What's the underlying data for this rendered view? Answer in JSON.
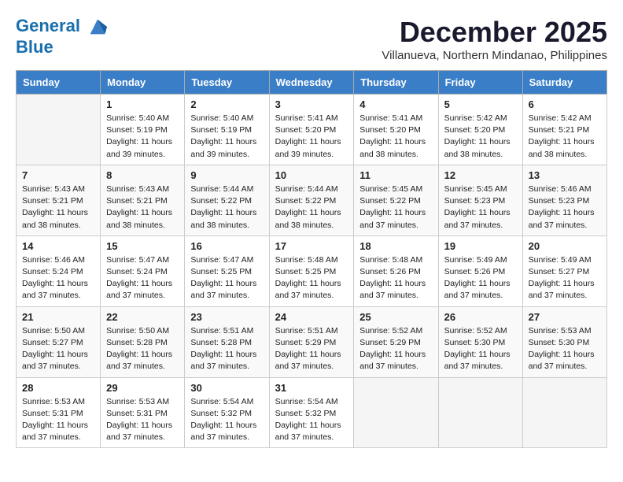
{
  "header": {
    "logo_line1": "General",
    "logo_line2": "Blue",
    "month_title": "December 2025",
    "subtitle": "Villanueva, Northern Mindanao, Philippines"
  },
  "days_of_week": [
    "Sunday",
    "Monday",
    "Tuesday",
    "Wednesday",
    "Thursday",
    "Friday",
    "Saturday"
  ],
  "weeks": [
    [
      {
        "day": "",
        "empty": true
      },
      {
        "day": "1",
        "sunrise": "5:40 AM",
        "sunset": "5:19 PM",
        "daylight": "11 hours and 39 minutes."
      },
      {
        "day": "2",
        "sunrise": "5:40 AM",
        "sunset": "5:19 PM",
        "daylight": "11 hours and 39 minutes."
      },
      {
        "day": "3",
        "sunrise": "5:41 AM",
        "sunset": "5:20 PM",
        "daylight": "11 hours and 39 minutes."
      },
      {
        "day": "4",
        "sunrise": "5:41 AM",
        "sunset": "5:20 PM",
        "daylight": "11 hours and 38 minutes."
      },
      {
        "day": "5",
        "sunrise": "5:42 AM",
        "sunset": "5:20 PM",
        "daylight": "11 hours and 38 minutes."
      },
      {
        "day": "6",
        "sunrise": "5:42 AM",
        "sunset": "5:21 PM",
        "daylight": "11 hours and 38 minutes."
      }
    ],
    [
      {
        "day": "7",
        "sunrise": "5:43 AM",
        "sunset": "5:21 PM",
        "daylight": "11 hours and 38 minutes."
      },
      {
        "day": "8",
        "sunrise": "5:43 AM",
        "sunset": "5:21 PM",
        "daylight": "11 hours and 38 minutes."
      },
      {
        "day": "9",
        "sunrise": "5:44 AM",
        "sunset": "5:22 PM",
        "daylight": "11 hours and 38 minutes."
      },
      {
        "day": "10",
        "sunrise": "5:44 AM",
        "sunset": "5:22 PM",
        "daylight": "11 hours and 38 minutes."
      },
      {
        "day": "11",
        "sunrise": "5:45 AM",
        "sunset": "5:22 PM",
        "daylight": "11 hours and 37 minutes."
      },
      {
        "day": "12",
        "sunrise": "5:45 AM",
        "sunset": "5:23 PM",
        "daylight": "11 hours and 37 minutes."
      },
      {
        "day": "13",
        "sunrise": "5:46 AM",
        "sunset": "5:23 PM",
        "daylight": "11 hours and 37 minutes."
      }
    ],
    [
      {
        "day": "14",
        "sunrise": "5:46 AM",
        "sunset": "5:24 PM",
        "daylight": "11 hours and 37 minutes."
      },
      {
        "day": "15",
        "sunrise": "5:47 AM",
        "sunset": "5:24 PM",
        "daylight": "11 hours and 37 minutes."
      },
      {
        "day": "16",
        "sunrise": "5:47 AM",
        "sunset": "5:25 PM",
        "daylight": "11 hours and 37 minutes."
      },
      {
        "day": "17",
        "sunrise": "5:48 AM",
        "sunset": "5:25 PM",
        "daylight": "11 hours and 37 minutes."
      },
      {
        "day": "18",
        "sunrise": "5:48 AM",
        "sunset": "5:26 PM",
        "daylight": "11 hours and 37 minutes."
      },
      {
        "day": "19",
        "sunrise": "5:49 AM",
        "sunset": "5:26 PM",
        "daylight": "11 hours and 37 minutes."
      },
      {
        "day": "20",
        "sunrise": "5:49 AM",
        "sunset": "5:27 PM",
        "daylight": "11 hours and 37 minutes."
      }
    ],
    [
      {
        "day": "21",
        "sunrise": "5:50 AM",
        "sunset": "5:27 PM",
        "daylight": "11 hours and 37 minutes."
      },
      {
        "day": "22",
        "sunrise": "5:50 AM",
        "sunset": "5:28 PM",
        "daylight": "11 hours and 37 minutes."
      },
      {
        "day": "23",
        "sunrise": "5:51 AM",
        "sunset": "5:28 PM",
        "daylight": "11 hours and 37 minutes."
      },
      {
        "day": "24",
        "sunrise": "5:51 AM",
        "sunset": "5:29 PM",
        "daylight": "11 hours and 37 minutes."
      },
      {
        "day": "25",
        "sunrise": "5:52 AM",
        "sunset": "5:29 PM",
        "daylight": "11 hours and 37 minutes."
      },
      {
        "day": "26",
        "sunrise": "5:52 AM",
        "sunset": "5:30 PM",
        "daylight": "11 hours and 37 minutes."
      },
      {
        "day": "27",
        "sunrise": "5:53 AM",
        "sunset": "5:30 PM",
        "daylight": "11 hours and 37 minutes."
      }
    ],
    [
      {
        "day": "28",
        "sunrise": "5:53 AM",
        "sunset": "5:31 PM",
        "daylight": "11 hours and 37 minutes."
      },
      {
        "day": "29",
        "sunrise": "5:53 AM",
        "sunset": "5:31 PM",
        "daylight": "11 hours and 37 minutes."
      },
      {
        "day": "30",
        "sunrise": "5:54 AM",
        "sunset": "5:32 PM",
        "daylight": "11 hours and 37 minutes."
      },
      {
        "day": "31",
        "sunrise": "5:54 AM",
        "sunset": "5:32 PM",
        "daylight": "11 hours and 37 minutes."
      },
      {
        "day": "",
        "empty": true
      },
      {
        "day": "",
        "empty": true
      },
      {
        "day": "",
        "empty": true
      }
    ]
  ],
  "labels": {
    "sunrise": "Sunrise:",
    "sunset": "Sunset:",
    "daylight": "Daylight:"
  }
}
